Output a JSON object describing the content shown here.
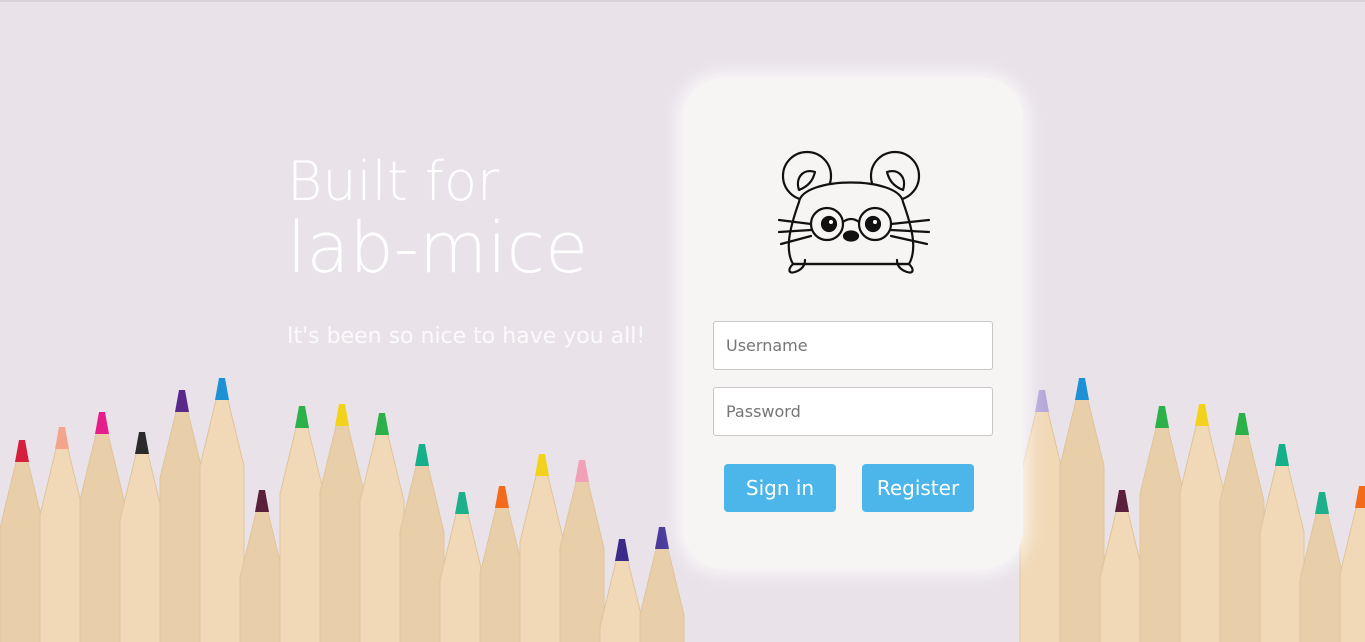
{
  "hero": {
    "line1": "Built for",
    "line2": "lab-mice",
    "subtitle": "It's been so nice to have you all!"
  },
  "login": {
    "logo_icon": "mouse-with-glasses-icon",
    "username_placeholder": "Username",
    "password_placeholder": "Password",
    "signin_label": "Sign in",
    "register_label": "Register"
  },
  "colors": {
    "background": "#e9e3e9",
    "card": "#f7f5f3",
    "button": "#4cb5e9",
    "hero_text": "#ffffff"
  },
  "pencil_tip_colors": [
    "#d61f3c",
    "#f2a58a",
    "#e61e8c",
    "#2b2b2b",
    "#5a2a8a",
    "#1e90d6",
    "#5a1f3a",
    "#2bb04a",
    "#f2d21a",
    "#2bb04a",
    "#14b08a",
    "#1db08a",
    "#f26a1a",
    "#f2d21a",
    "#f2a0b8",
    "#3a2a8a",
    "#4a3a9a",
    "#b6a8d8",
    "#1e90d6",
    "#5a1f3a",
    "#2bb04a",
    "#f2d21a",
    "#2bb04a",
    "#14b08a",
    "#1db08a",
    "#f26a1a"
  ]
}
